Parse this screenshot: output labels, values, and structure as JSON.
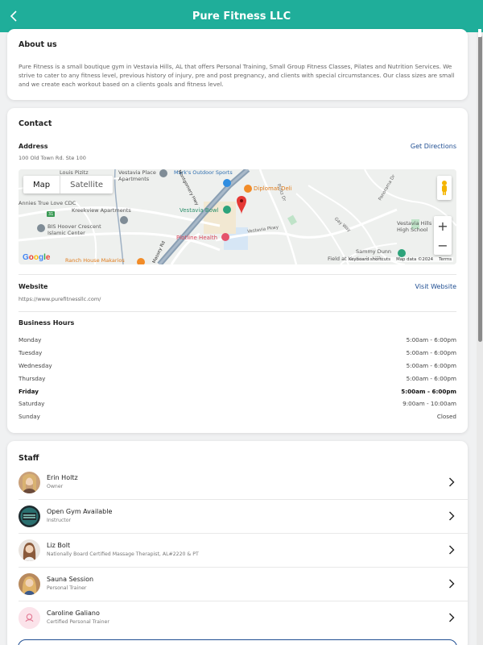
{
  "header": {
    "title": "Pure Fitness LLC",
    "back_icon": "chevron-left-icon",
    "background": "#1fae9a"
  },
  "about": {
    "title": "About us",
    "body": "Pure Fitness is a small boutique gym in Vestavia Hills, AL that offers Personal Training, Small Group Fitness Classes, Pilates and Nutrition Services. We strive to cater to any fitness level, previous history of injury, pre and post pregnancy, and clients with special circumstances. Our class sizes are small and we create each workout based on a clients goals and fitness level."
  },
  "contact": {
    "title": "Contact",
    "address_label": "Address",
    "address": "100 Old Town Rd. Ste 100",
    "directions_link": "Get Directions",
    "website_label": "Website",
    "website": "https://www.purefitnessllc.com/",
    "website_link": "Visit Website",
    "hours_label": "Business Hours",
    "hours": [
      {
        "day": "Monday",
        "time": "5:00am - 6:00pm",
        "bold": false
      },
      {
        "day": "Tuesday",
        "time": "5:00am - 6:00pm",
        "bold": false
      },
      {
        "day": "Wednesday",
        "time": "5:00am - 6:00pm",
        "bold": false
      },
      {
        "day": "Thursday",
        "time": "5:00am - 6:00pm",
        "bold": false
      },
      {
        "day": "Friday",
        "time": "5:00am - 6:00pm",
        "bold": true
      },
      {
        "day": "Saturday",
        "time": "9:00am - 10:00am",
        "bold": false
      },
      {
        "day": "Sunday",
        "time": "Closed",
        "bold": false
      }
    ]
  },
  "map": {
    "toggle_map": "Map",
    "toggle_satellite": "Satellite",
    "zoom_in": "+",
    "zoom_out": "−",
    "google": "Google",
    "attribution": {
      "shortcuts": "Keyboard shortcuts",
      "data": "Map data ©2024",
      "terms": "Terms"
    },
    "labels": {
      "louis": "Louis Pizitz",
      "vestavia_place": "Vestavia Place",
      "apartments": "Apartments",
      "marks": "Mark's Outdoor Sports",
      "diplomat": "Diplomat Deli",
      "pizitz_dr": "Pizitz Dr",
      "panorama": "Panorama Dr",
      "annies": "Annies True Love CDC",
      "kreekview": "Kreekview Apartments",
      "bis1": "BIS Hoover Crescent",
      "bis2": "Islamic Center",
      "vestavia_bowl": "Vestavia Bowl",
      "plotline": "Plotline Health",
      "vestavia_pkwy": "Vestavia Pkwy",
      "gay_way": "Gay Way",
      "vhhs1": "Vestavia Hills",
      "vhhs2": "High School",
      "ranch": "Ranch House Makarios",
      "sammy": "Sammy Dunn",
      "field": "Field at Vestavia Hills",
      "montgomery": "Montgomery Hwy",
      "massey": "Massey Rd",
      "route": "31"
    },
    "marker_color": "#e53935"
  },
  "staff": {
    "title": "Staff",
    "members": [
      {
        "name": "Erin Holtz",
        "role": "Owner"
      },
      {
        "name": "Open Gym Available",
        "role": "Instructor"
      },
      {
        "name": "Liz Bolt",
        "role": "Nationally Board Certified Massage Therapist, AL#2220 & PT"
      },
      {
        "name": "Sauna Session",
        "role": "Personal Trainer"
      },
      {
        "name": "Caroline Galiano",
        "role": "Certified Personal Trainer"
      }
    ]
  }
}
